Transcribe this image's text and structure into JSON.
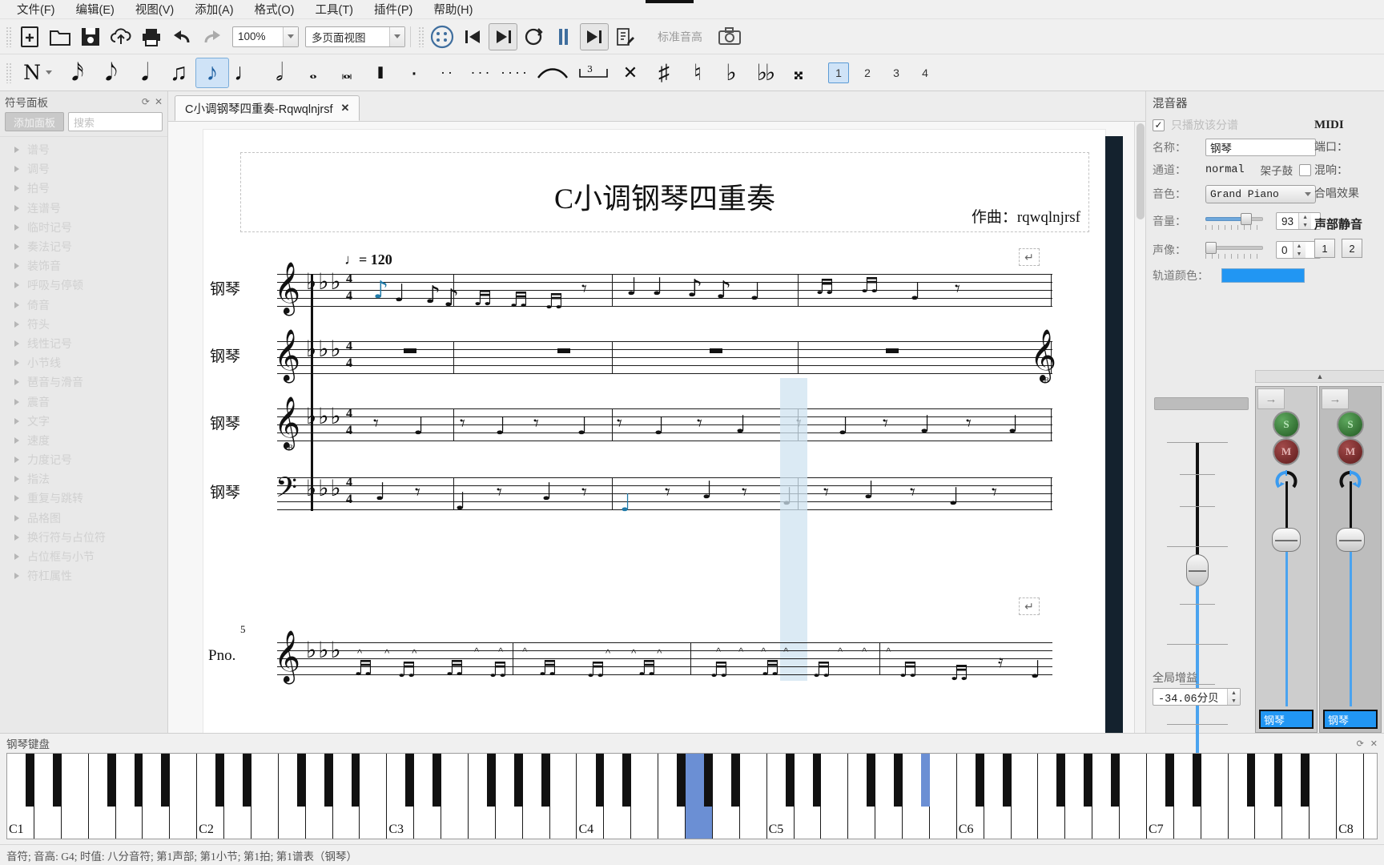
{
  "app": {
    "title": "C小调钢琴四重奏-Rqwqlnjrsf"
  },
  "menubar": {
    "items": [
      {
        "label": "文件(F)",
        "name": "menu-file"
      },
      {
        "label": "编辑(E)",
        "name": "menu-edit"
      },
      {
        "label": "视图(V)",
        "name": "menu-view"
      },
      {
        "label": "添加(A)",
        "name": "menu-add"
      },
      {
        "label": "格式(O)",
        "name": "menu-format"
      },
      {
        "label": "工具(T)",
        "name": "menu-tools"
      },
      {
        "label": "插件(P)",
        "name": "menu-plugins"
      },
      {
        "label": "帮助(H)",
        "name": "menu-help"
      }
    ]
  },
  "toolbar": {
    "zoom_value": "100%",
    "view_mode": "多页面视图",
    "concert_pitch_label": "标准音高",
    "icons": [
      "new-file-icon",
      "open-folder-icon",
      "save-icon",
      "cloud-upload-icon",
      "print-icon",
      "undo-icon",
      "redo-icon",
      "play-panel-icon",
      "rewind-icon",
      "play-icon",
      "loop-icon",
      "metronome-icon",
      "fast-forward-icon",
      "midi-input-icon",
      "camera-icon"
    ]
  },
  "notepalette": {
    "voice_numbers": [
      "1",
      "2",
      "3",
      "4"
    ],
    "active_voice": "1",
    "active_duration": "eighth-note",
    "items": [
      "note-input-mode",
      "sixty-fourth-note",
      "thirty-second-note",
      "sixteenth-note",
      "eighth-note-small",
      "eighth-note",
      "quarter-note",
      "half-note",
      "whole-note",
      "breve-note",
      "longa-note",
      "double-whole-note",
      "augmentation-dot",
      "double-dot",
      "triple-dot",
      "quadruple-dot",
      "tie",
      "tuplet",
      "flip-direction",
      "sharp",
      "natural",
      "flat",
      "double-flat",
      "double-sharp"
    ]
  },
  "leftpanel": {
    "title": "符号面板",
    "add_button": "添加面板",
    "search_placeholder": "搜索",
    "items": [
      {
        "label": "谱号"
      },
      {
        "label": "调号"
      },
      {
        "label": "拍号"
      },
      {
        "label": "连谱号"
      },
      {
        "label": "临时记号"
      },
      {
        "label": "奏法记号"
      },
      {
        "label": "装饰音"
      },
      {
        "label": "呼吸与停顿"
      },
      {
        "label": "倚音"
      },
      {
        "label": "符头"
      },
      {
        "label": "线性记号"
      },
      {
        "label": "小节线"
      },
      {
        "label": "琶音与滑音"
      },
      {
        "label": "震音"
      },
      {
        "label": "文字"
      },
      {
        "label": "速度"
      },
      {
        "label": "力度记号"
      },
      {
        "label": "指法"
      },
      {
        "label": "重复与跳转"
      },
      {
        "label": "品格图"
      },
      {
        "label": "换行符与占位符"
      },
      {
        "label": "占位框与小节"
      },
      {
        "label": "符杠属性"
      }
    ]
  },
  "score": {
    "tab_label": "C小调钢琴四重奏-Rqwqlnjrsf",
    "title": "C小调钢琴四重奏",
    "composer": "作曲：rqwqlnjrsf",
    "tempo": "♩= 120",
    "measure_number": "5",
    "time_signature": "4/4",
    "key_signature": "3 flats (E♭ major / C minor)",
    "staves": [
      {
        "instrument": "钢琴",
        "clef": "treble"
      },
      {
        "instrument": "钢琴",
        "clef": "treble-8vb"
      },
      {
        "instrument": "钢琴",
        "clef": "treble-8vb"
      },
      {
        "instrument": "钢琴",
        "clef": "bass"
      }
    ],
    "second_system_label": "Pno."
  },
  "mixer": {
    "title": "混音器",
    "solo_score_label": "只播放该分谱",
    "solo_score_checked": true,
    "name_label": "名称：",
    "name_value": "钢琴",
    "channel_label": "通道：",
    "channel_value": "normal",
    "drumset_label": "架子鼓",
    "drumset_checked": false,
    "sound_label": "音色：",
    "sound_value": "Grand Piano",
    "volume_label": "音量：",
    "volume_value": "93",
    "pan_label": "声像：",
    "pan_value": "0",
    "track_color_label": "轨道颜色：",
    "track_color": "#2196f3",
    "midi": {
      "title": "MIDI",
      "port_label": "端口：",
      "reverb_label": "混响：",
      "chorus_label": "合唱效果"
    },
    "voice_mute": {
      "title": "声部静音",
      "buttons": [
        "1",
        "2"
      ]
    },
    "global_gain_label": "全局增益",
    "global_gain_value": "-34.06分贝",
    "strips": [
      {
        "label": "钢琴",
        "solo": "S",
        "mute": "M"
      },
      {
        "label": "钢琴",
        "solo": "S",
        "mute": "M"
      }
    ]
  },
  "piano": {
    "title": "钢琴键盘",
    "octave_labels": [
      "C1",
      "C2",
      "C3",
      "C4",
      "C5",
      "C6",
      "C7",
      "C8"
    ],
    "highlighted_keys": [
      "G4-blue-dark",
      "A5-blue-light"
    ]
  },
  "statusbar": {
    "text": "音符; 音高: G4; 时值: 八分音符; 第1声部;   第1小节; 第1拍; 第1谱表（钢琴）"
  }
}
